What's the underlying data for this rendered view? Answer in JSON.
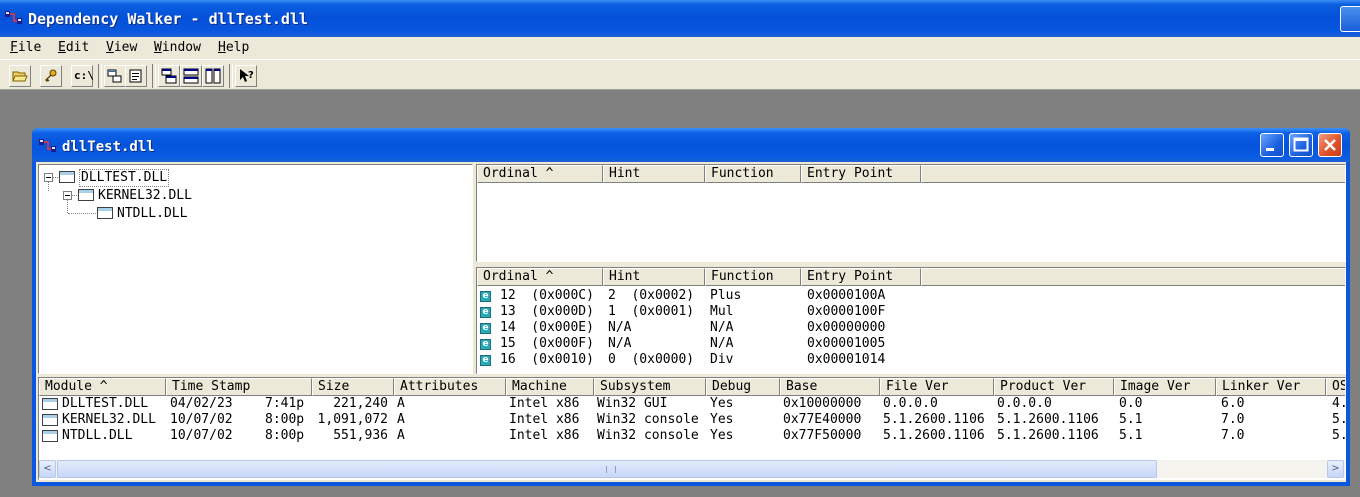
{
  "app": {
    "title": "Dependency Walker - dllTest.dll",
    "menu": [
      "File",
      "Edit",
      "View",
      "Window",
      "Help"
    ],
    "menu_underline": [
      "F",
      "E",
      "V",
      "W",
      "H"
    ],
    "toolbar": {
      "path_button_label": "c:\\"
    }
  },
  "child": {
    "title": "dllTest.dll"
  },
  "tree": {
    "items": [
      {
        "label": "DLLTEST.DLL",
        "level": 0
      },
      {
        "label": "KERNEL32.DLL",
        "level": 1
      },
      {
        "label": "NTDLL.DLL",
        "level": 2
      }
    ]
  },
  "imports": {
    "headers": [
      "Ordinal ^",
      "Hint",
      "Function",
      "Entry Point"
    ],
    "rows": []
  },
  "exports": {
    "headers": [
      "Ordinal ^",
      "Hint",
      "Function",
      "Entry Point"
    ],
    "rows": [
      {
        "ordinal": "12  (0x000C)",
        "hint": "2  (0x0002)",
        "function": "Plus",
        "entry": "0x0000100A"
      },
      {
        "ordinal": "13  (0x000D)",
        "hint": "1  (0x0001)",
        "function": "Mul",
        "entry": "0x0000100F"
      },
      {
        "ordinal": "14  (0x000E)",
        "hint": "N/A",
        "function": "N/A",
        "entry": "0x00000000"
      },
      {
        "ordinal": "15  (0x000F)",
        "hint": "N/A",
        "function": "N/A",
        "entry": "0x00001005"
      },
      {
        "ordinal": "16  (0x0010)",
        "hint": "0  (0x0000)",
        "function": "Div",
        "entry": "0x00001014"
      }
    ]
  },
  "modules": {
    "headers": [
      "Module ^",
      "Time Stamp",
      "Size",
      "Attributes",
      "Machine",
      "Subsystem",
      "Debug",
      "Base",
      "File Ver",
      "Product Ver",
      "Image Ver",
      "Linker Ver",
      "OS"
    ],
    "rows": [
      {
        "module": "DLLTEST.DLL",
        "date": "04/02/23",
        "time": "7:41p",
        "size": "221,240",
        "attr": "A",
        "machine": "Intel x86",
        "subsystem": "Win32 GUI",
        "debug": "Yes",
        "base": "0x10000000",
        "filever": "0.0.0.0",
        "prodver": "0.0.0.0",
        "imagever": "0.0",
        "linkerver": "6.0",
        "os": "4."
      },
      {
        "module": "KERNEL32.DLL",
        "date": "10/07/02",
        "time": "8:00p",
        "size": "1,091,072",
        "attr": "A",
        "machine": "Intel x86",
        "subsystem": "Win32 console",
        "debug": "Yes",
        "base": "0x77E40000",
        "filever": "5.1.2600.1106",
        "prodver": "5.1.2600.1106",
        "imagever": "5.1",
        "linkerver": "7.0",
        "os": "5."
      },
      {
        "module": "NTDLL.DLL",
        "date": "10/07/02",
        "time": "8:00p",
        "size": "551,936",
        "attr": "A",
        "machine": "Intel x86",
        "subsystem": "Win32 console",
        "debug": "Yes",
        "base": "0x77F50000",
        "filever": "5.1.2600.1106",
        "prodver": "5.1.2600.1106",
        "imagever": "5.1",
        "linkerver": "7.0",
        "os": "5."
      }
    ]
  },
  "scroll": {
    "left_arrow": "<",
    "right_arrow": ">"
  },
  "colors": {
    "titlebar": "#0a58e0",
    "face": "#ece9d8",
    "export_icon": "#2aa8b8",
    "close_button": "#e0522c"
  }
}
